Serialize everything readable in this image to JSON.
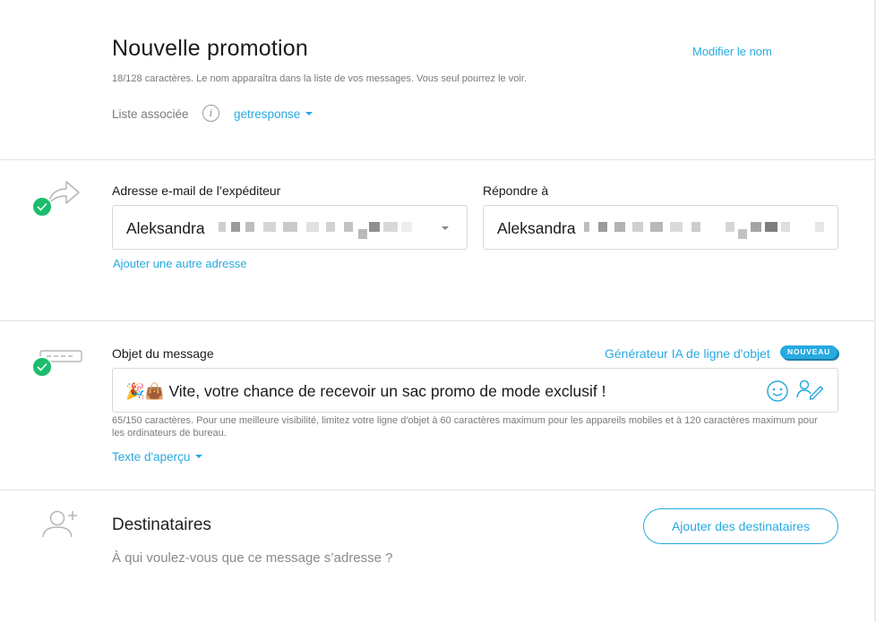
{
  "header": {
    "title": "Nouvelle promotion",
    "rename_link": "Modifier le nom",
    "name_hint": "18/128 caractères. Le nom apparaîtra dans la liste de vos messages. Vous seul pourrez le voir.",
    "list_label": "Liste associée",
    "info_icon": "i",
    "list_value": "getresponse"
  },
  "sender": {
    "from_label": "Adresse e-mail de l’expéditeur",
    "from_value": "Aleksandra",
    "add_address_link": "Ajouter une autre adresse",
    "reply_label": "Répondre à",
    "reply_value": "Aleksandra"
  },
  "subject": {
    "label": "Objet du message",
    "ai_link": "Générateur IA de ligne d'objet",
    "badge": "NOUVEAU",
    "value": "🎉👜 Vite, votre chance de recevoir un sac promo de mode exclusif !",
    "char_hint": "65/150 caractères. Pour une meilleure visibilité, limitez votre ligne d'objet à 60 caractères maximum pour les appareils mobiles et à 120 caractères maximum pour les ordinateurs de bureau.",
    "preview_link": "Texte d'aperçu"
  },
  "recipients": {
    "title": "Destinataires",
    "subtitle": "À qui voulez-vous que ce message s’adresse ?",
    "add_button": "Ajouter des destinataires"
  },
  "colors": {
    "accent": "#27aae1",
    "success": "#1bbd6d",
    "text": "#1a1a1a",
    "muted": "#7a7a7a",
    "border": "#d9d9d9"
  },
  "icons": [
    "info-icon",
    "forward-arrow-icon",
    "checkmark-icon",
    "subject-line-icon",
    "emoji-icon",
    "signature-icon",
    "add-user-icon",
    "dropdown-caret-icon"
  ]
}
